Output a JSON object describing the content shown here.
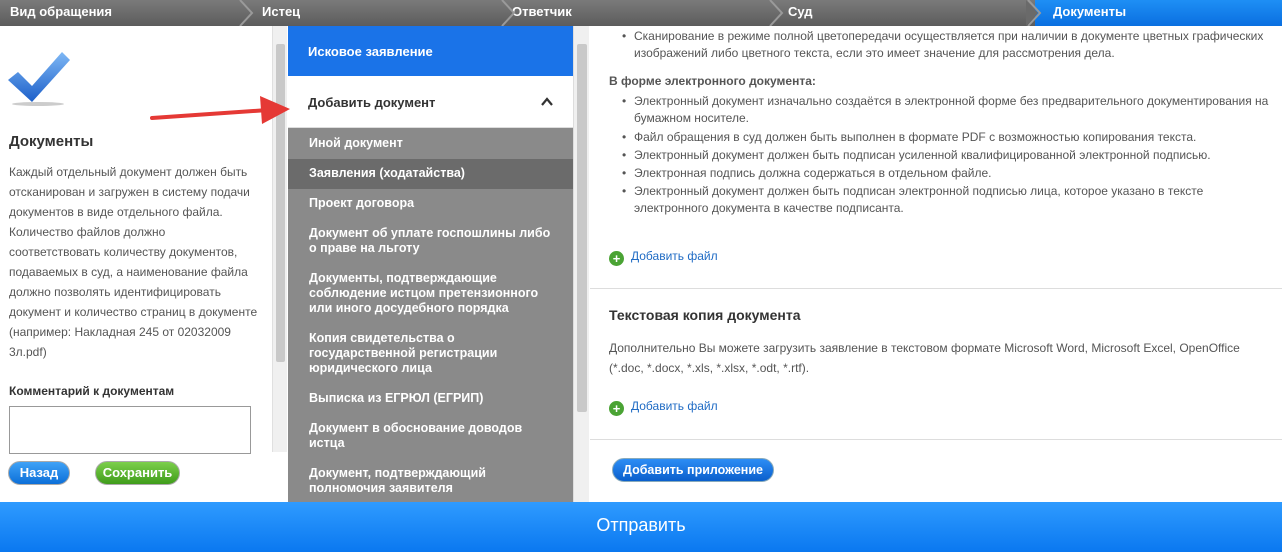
{
  "steps": [
    "Вид обращения",
    "Истец",
    "Ответчик",
    "Суд",
    "Документы"
  ],
  "left": {
    "title": "Документы",
    "description": "Каждый отдельный документ должен быть отсканирован и загружен в систему подачи документов в виде отдельного файла. Количество файлов должно соответствовать количеству документов, подаваемых в суд, а наименование файла должно позволять идентифицировать документ и количество страниц в документе (например: Накладная 245 от 02032009 3л.pdf)",
    "comment_label": "Комментарий к документам",
    "comment_value": "",
    "back_label": "Назад",
    "save_label": "Сохранить"
  },
  "nav": {
    "header": "Исковое заявление",
    "add_document": "Добавить документ",
    "items": [
      "Иной документ",
      "Заявления (ходатайства)",
      "Проект договора",
      "Документ об уплате госпошлины либо о праве на льготу",
      "Документы, подтверждающие соблюдение истцом претензионного или иного досудебного порядка",
      "Копия свидетельства о государственной регистрации юридического лица",
      "Выписка из ЕГРЮЛ (ЕГРИП)",
      "Документ в обоснование доводов истца",
      "Документ, подтверждающий полномочия заявителя"
    ],
    "selected_index": 1
  },
  "right": {
    "top_bullet": "Сканирование в режиме полной цветопередачи осуществляется при наличии в документе цветных графических изображений либо цветного текста, если это имеет значение для рассмотрения дела.",
    "electronic_heading": "В форме электронного документа:",
    "bullets": [
      "Электронный документ изначально создаётся в электронной форме без предварительного документирования на бумажном носителе.",
      "Файл обращения в суд должен быть выполнен в формате PDF с возможностью копирования текста.",
      "Электронный документ должен быть подписан усиленной квалифицированной электронной подписью.",
      "Электронная подпись должна содержаться в отдельном файле.",
      "Электронный документ должен быть подписан электронной подписью лица, которое указано в тексте электронного документа в качестве подписанта."
    ],
    "add_file": "Добавить файл",
    "text_copy_title": "Текстовая копия документа",
    "text_copy_desc": "Дополнительно Вы можете загрузить заявление в текстовом формате Microsoft Word, Microsoft Excel, OpenOffice (*.doc, *.docx, *.xls, *.xlsx, *.odt, *.rtf).",
    "add_attachment": "Добавить приложение"
  },
  "footer": {
    "submit_label": "Отправить"
  },
  "colors": {
    "accent": "#1a73e8",
    "nav_bg": "#8a8a8a",
    "save_green": "#4aa334",
    "arrow_red": "#e53935"
  }
}
